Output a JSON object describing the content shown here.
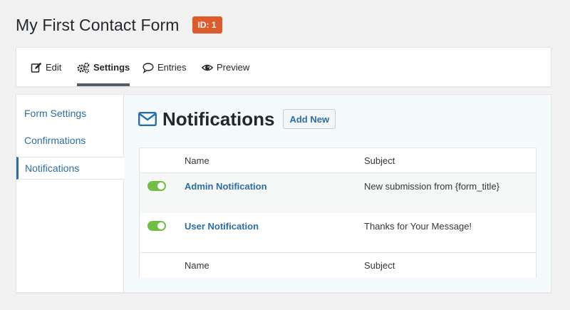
{
  "header": {
    "title": "My First Contact Form",
    "id_badge": "ID: 1"
  },
  "tabs": [
    {
      "label": "Edit",
      "icon": "edit-icon",
      "active": false
    },
    {
      "label": "Settings",
      "icon": "gears-icon",
      "active": true
    },
    {
      "label": "Entries",
      "icon": "speech-bubble-icon",
      "active": false
    },
    {
      "label": "Preview",
      "icon": "eye-icon",
      "active": false
    }
  ],
  "sidebar": {
    "items": [
      {
        "label": "Form Settings",
        "active": false
      },
      {
        "label": "Confirmations",
        "active": false
      },
      {
        "label": "Notifications",
        "active": true
      }
    ]
  },
  "notifications": {
    "title": "Notifications",
    "icon": "envelope-icon",
    "add_new_label": "Add New",
    "columns": [
      "Name",
      "Subject"
    ],
    "rows": [
      {
        "enabled": true,
        "name": "Admin Notification",
        "subject": "New submission from {form_title}"
      },
      {
        "enabled": true,
        "name": "User Notification",
        "subject": "Thanks for Your Message!"
      }
    ]
  },
  "colors": {
    "accent": "#2b6ea5",
    "badge": "#dd5a2b",
    "toggle_on": "#6fbf45"
  }
}
